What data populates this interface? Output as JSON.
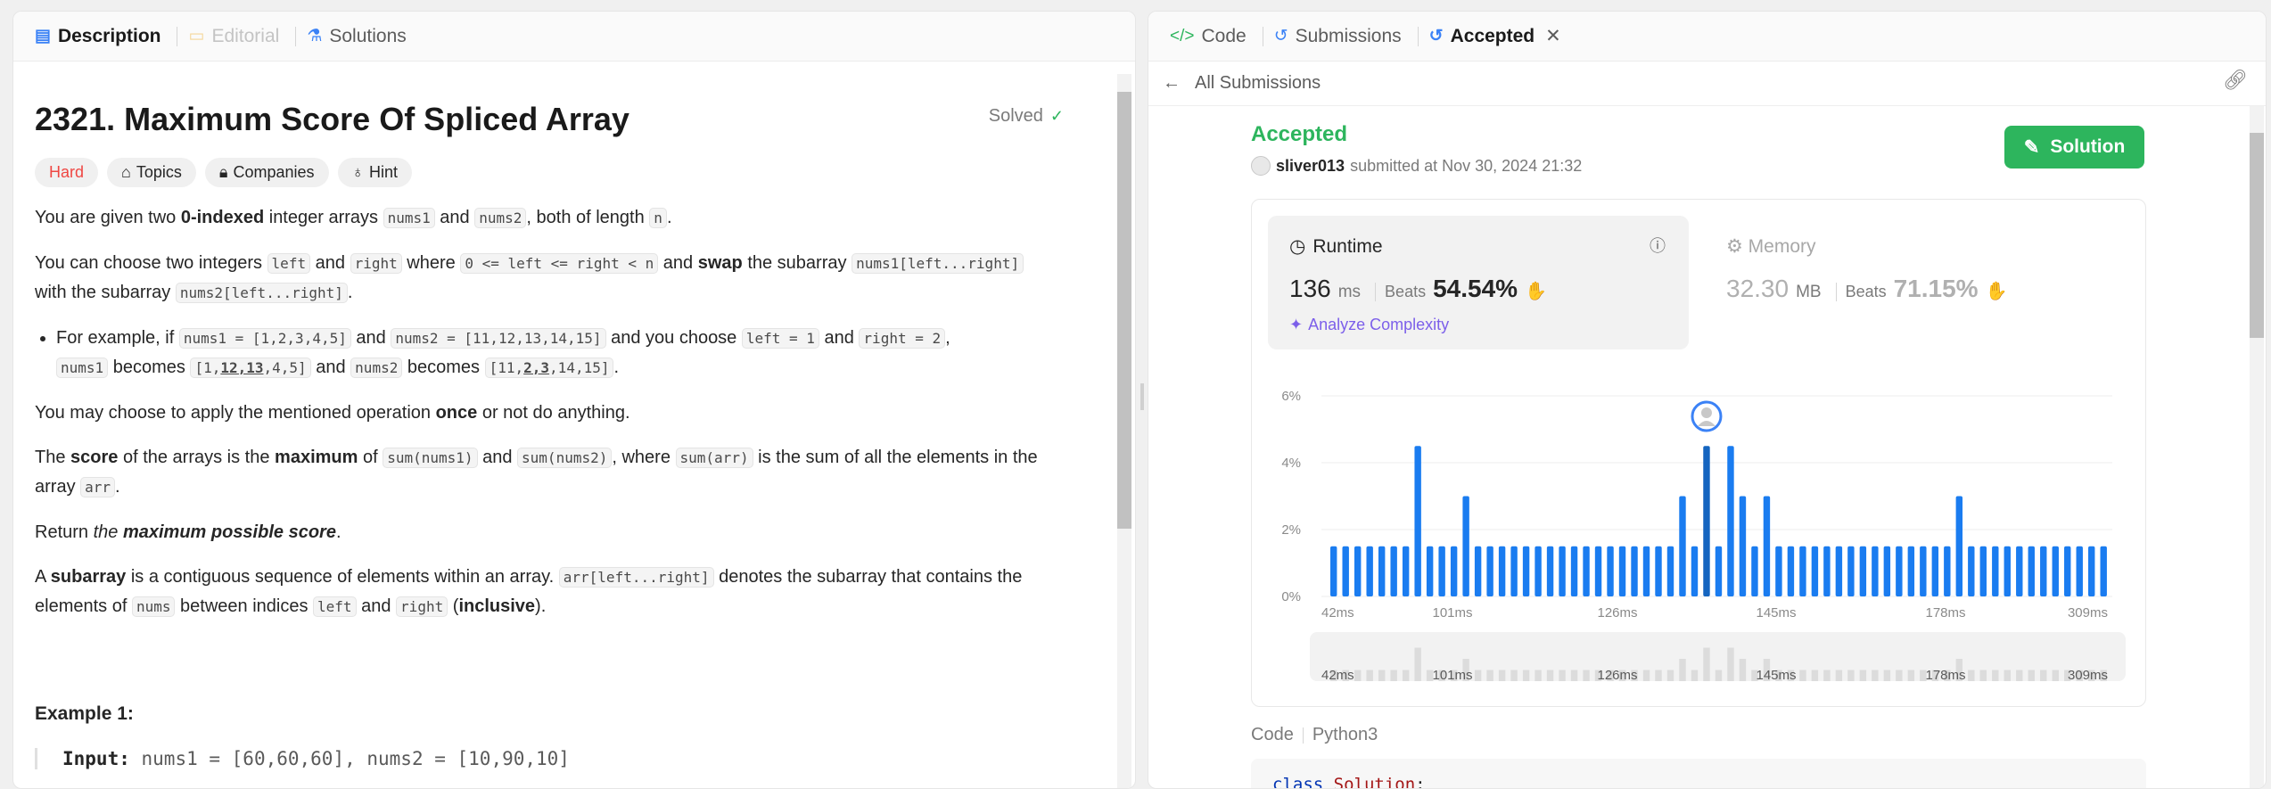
{
  "left_tabs": [
    {
      "label": "Description",
      "icon": "description-icon",
      "state": "active"
    },
    {
      "label": "Editorial",
      "icon": "editorial-icon",
      "state": "disabled"
    },
    {
      "label": "Solutions",
      "icon": "flask-icon",
      "state": "normal"
    }
  ],
  "problem": {
    "title": "2321. Maximum Score Of Spliced Array",
    "solved_label": "Solved",
    "difficulty": "Hard",
    "badges": [
      "Topics",
      "Companies",
      "Hint"
    ],
    "p1": {
      "a": "You are given two ",
      "b": "0-indexed",
      "c": " integer arrays ",
      "code1": "nums1",
      "d": " and ",
      "code2": "nums2",
      "e": ", both of length ",
      "code3": "n",
      "f": "."
    },
    "p2": {
      "a": "You can choose two integers ",
      "code1": "left",
      "b": " and ",
      "code2": "right",
      "c": " where ",
      "code3": "0 <= left <= right < n",
      "d": " and ",
      "e": "swap",
      "f": " the subarray ",
      "code4": "nums1[left...right]",
      "g": "with the subarray ",
      "code5": "nums2[left...right]",
      "h": "."
    },
    "li": {
      "a": "For example, if ",
      "code1": "nums1 = [1,2,3,4,5]",
      "b": " and ",
      "code2": "nums2 = [11,12,13,14,15]",
      "c": " and you choose ",
      "code3": "left = 1",
      "d": " and ",
      "code4": "right = 2",
      "e": ",",
      "code5": "nums1",
      "f": " becomes ",
      "code6a": "[1,",
      "code6b": "12,13",
      "code6c": ",4,5]",
      "g": " and ",
      "code7": "nums2",
      "h": " becomes ",
      "code8a": "[11,",
      "code8b": "2,3",
      "code8c": ",14,15]",
      "i": "."
    },
    "p3": {
      "a": "You may choose to apply the mentioned operation ",
      "b": "once",
      "c": " or not do anything."
    },
    "p4": {
      "a": "The ",
      "b": "score",
      "c": " of the arrays is the ",
      "d": "maximum",
      "e": " of ",
      "code1": "sum(nums1)",
      "f": " and ",
      "code2": "sum(nums2)",
      "g": ", where ",
      "code3": "sum(arr)",
      "h": " is the sum of all the elements in the",
      "i": "array ",
      "code4": "arr",
      "j": "."
    },
    "p5": {
      "a": "Return ",
      "b": "the ",
      "c": "maximum possible score",
      "d": "."
    },
    "p6": {
      "a": "A ",
      "b": "subarray",
      "c": " is a contiguous sequence of elements within an array. ",
      "code1": "arr[left...right]",
      "d": " denotes the subarray that contains the",
      "e": "elements of ",
      "code2": "nums",
      "f": " between indices ",
      "code3": "left",
      "g": " and ",
      "code4": "right",
      "h": " (",
      "i": "inclusive",
      "j": ")."
    },
    "example_title": "Example 1:",
    "example_input_label": "Input:",
    "example_input_value": "nums1 = [60,60,60], nums2 = [10,90,10]"
  },
  "right_tabs": [
    {
      "label": "Code",
      "icon": "code-icon",
      "state": "normal"
    },
    {
      "label": "Submissions",
      "icon": "history-icon",
      "state": "normal"
    },
    {
      "label": "Accepted",
      "icon": "history-icon",
      "state": "active"
    }
  ],
  "back_label": "All Submissions",
  "submission": {
    "status": "Accepted",
    "user": "sliver013",
    "submitted_text": "submitted at Nov 30, 2024 21:32",
    "solution_button": "Solution",
    "runtime_label": "Runtime",
    "runtime_value": "136",
    "runtime_unit": "ms",
    "beats_label": "Beats",
    "runtime_beats": "54.54%",
    "analyze_label": "Analyze Complexity",
    "memory_label": "Memory",
    "memory_value": "32.30",
    "memory_unit": "MB",
    "memory_beats": "71.15%"
  },
  "code_label": "Code",
  "code_lang": "Python3",
  "code_line": {
    "kw": "class",
    "name": "Solution",
    "rest": ":"
  },
  "colors": {
    "accent_green": "#2db55d",
    "bar_blue": "#1a7cf0",
    "hard_red": "#ef4743",
    "analyze_purple": "#7c5fea"
  },
  "chart_data": {
    "type": "bar",
    "xlabel": "",
    "ylabel": "",
    "yticks": [
      "0%",
      "2%",
      "4%",
      "6%"
    ],
    "ylim": [
      0,
      6
    ],
    "xtick_labels": [
      "42ms",
      "101ms",
      "126ms",
      "145ms",
      "178ms",
      "309ms"
    ],
    "values": [
      1.5,
      1.5,
      1.5,
      1.5,
      1.5,
      1.5,
      1.5,
      4.5,
      1.5,
      1.5,
      1.5,
      3.0,
      1.5,
      1.5,
      1.5,
      1.5,
      1.5,
      1.5,
      1.5,
      1.5,
      1.5,
      1.5,
      1.5,
      1.5,
      1.5,
      1.5,
      1.5,
      1.5,
      1.5,
      3.0,
      1.5,
      4.5,
      1.5,
      4.5,
      3.0,
      1.5,
      3.0,
      1.5,
      1.5,
      1.5,
      1.5,
      1.5,
      1.5,
      1.5,
      1.5,
      1.5,
      1.5,
      1.5,
      1.5,
      1.5,
      1.5,
      1.5,
      3.0,
      1.5,
      1.5,
      1.5,
      1.5,
      1.5,
      1.5,
      1.5,
      1.5,
      1.5,
      1.5,
      1.5,
      1.5
    ],
    "highlight_index": 31,
    "grid": true
  }
}
